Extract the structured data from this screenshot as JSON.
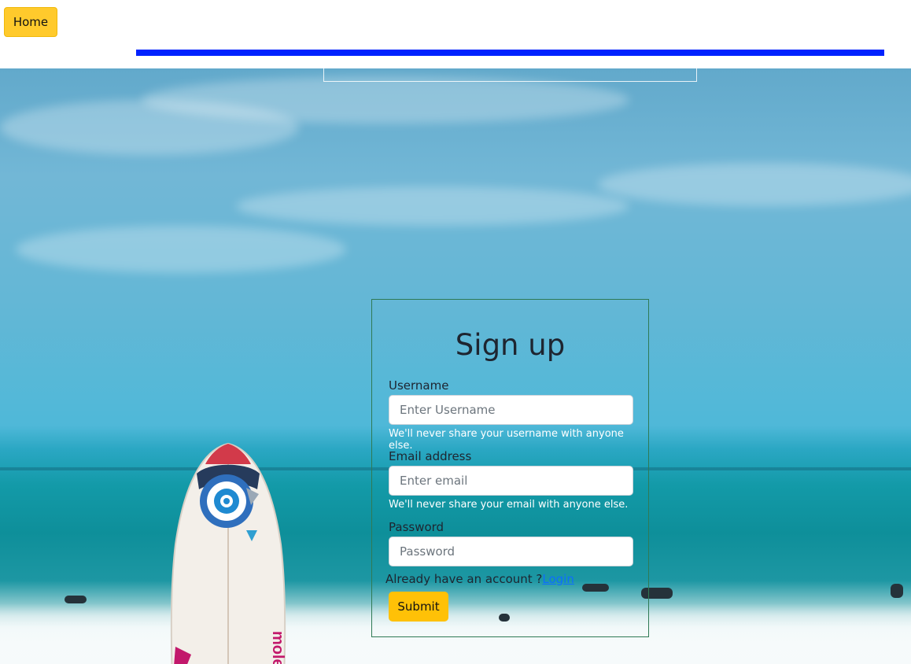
{
  "nav": {
    "home_label": "Home"
  },
  "colors": {
    "accent": "#ffc107",
    "bar": "#0022ff",
    "link": "#0d6efd",
    "card_border": "#2f7a55"
  },
  "signup": {
    "title": "Sign up",
    "username_label": "Username",
    "username_placeholder": "Enter Username",
    "username_help": "We'll never share your username with anyone else.",
    "email_label": "Email address",
    "email_placeholder": "Enter email",
    "email_help": "We'll never share your email with anyone else.",
    "password_label": "Password",
    "password_placeholder": "Password",
    "account_text": "Already have an account ?",
    "login_label": "Login",
    "submit_label": "Submit"
  },
  "background": {
    "image": "beach-surfboard-photo"
  }
}
